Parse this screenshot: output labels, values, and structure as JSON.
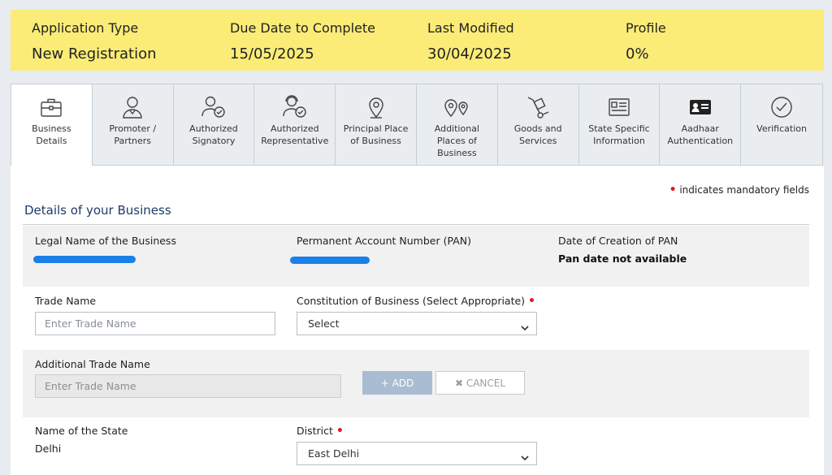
{
  "header": {
    "application_type_label": "Application Type",
    "application_type_value": "New Registration",
    "due_date_label": "Due Date to Complete",
    "due_date_value": "15/05/2025",
    "last_modified_label": "Last Modified",
    "last_modified_value": "30/04/2025",
    "profile_label": "Profile",
    "profile_value": "0%"
  },
  "tabs": [
    {
      "line1": "Business",
      "line2": "Details",
      "line3": "",
      "icon": "briefcase-icon"
    },
    {
      "line1": "Promoter /",
      "line2": "Partners",
      "line3": "",
      "icon": "person-icon"
    },
    {
      "line1": "Authorized",
      "line2": "Signatory",
      "line3": "",
      "icon": "person-check-icon"
    },
    {
      "line1": "Authorized",
      "line2": "Representative",
      "line3": "",
      "icon": "person-headset-check-icon"
    },
    {
      "line1": "Principal Place",
      "line2": "of Business",
      "line3": "",
      "icon": "location-pin-icon"
    },
    {
      "line1": "Additional",
      "line2": "Places of",
      "line3": "Business",
      "icon": "double-location-pin-icon"
    },
    {
      "line1": "Goods and",
      "line2": "Services",
      "line3": "",
      "icon": "hand-truck-icon"
    },
    {
      "line1": "State Specific",
      "line2": "Information",
      "line3": "",
      "icon": "id-card-icon"
    },
    {
      "line1": "Aadhaar",
      "line2": "Authentication",
      "line3": "",
      "icon": "aadhaar-card-icon"
    },
    {
      "line1": "Verification",
      "line2": "",
      "line3": "",
      "icon": "check-circle-icon"
    }
  ],
  "form": {
    "mandatory_note": "indicates mandatory fields",
    "mandatory_marker": "•",
    "section_title": "Details of your Business",
    "legal_name_label": "Legal Name of the Business",
    "pan_label": "Permanent Account Number (PAN)",
    "pan_date_label": "Date of Creation of PAN",
    "pan_date_value": "Pan date not available",
    "trade_name_label": "Trade Name",
    "trade_name_placeholder": "Enter Trade Name",
    "constitution_label": "Constitution of Business (Select Appropriate)",
    "constitution_value": "Select",
    "additional_trade_name_label": "Additional Trade Name",
    "additional_trade_name_placeholder": "Enter Trade Name",
    "add_button": "+ ADD",
    "cancel_button": "✖ CANCEL",
    "state_label": "Name of the State",
    "state_value": "Delhi",
    "district_label": "District",
    "district_value": "East Delhi"
  },
  "colors": {
    "header_bg": "#fbec77",
    "accent_blue": "#1f3b68",
    "mandatory_red": "#e01b1b",
    "add_button_bg": "#a9bcd1"
  }
}
